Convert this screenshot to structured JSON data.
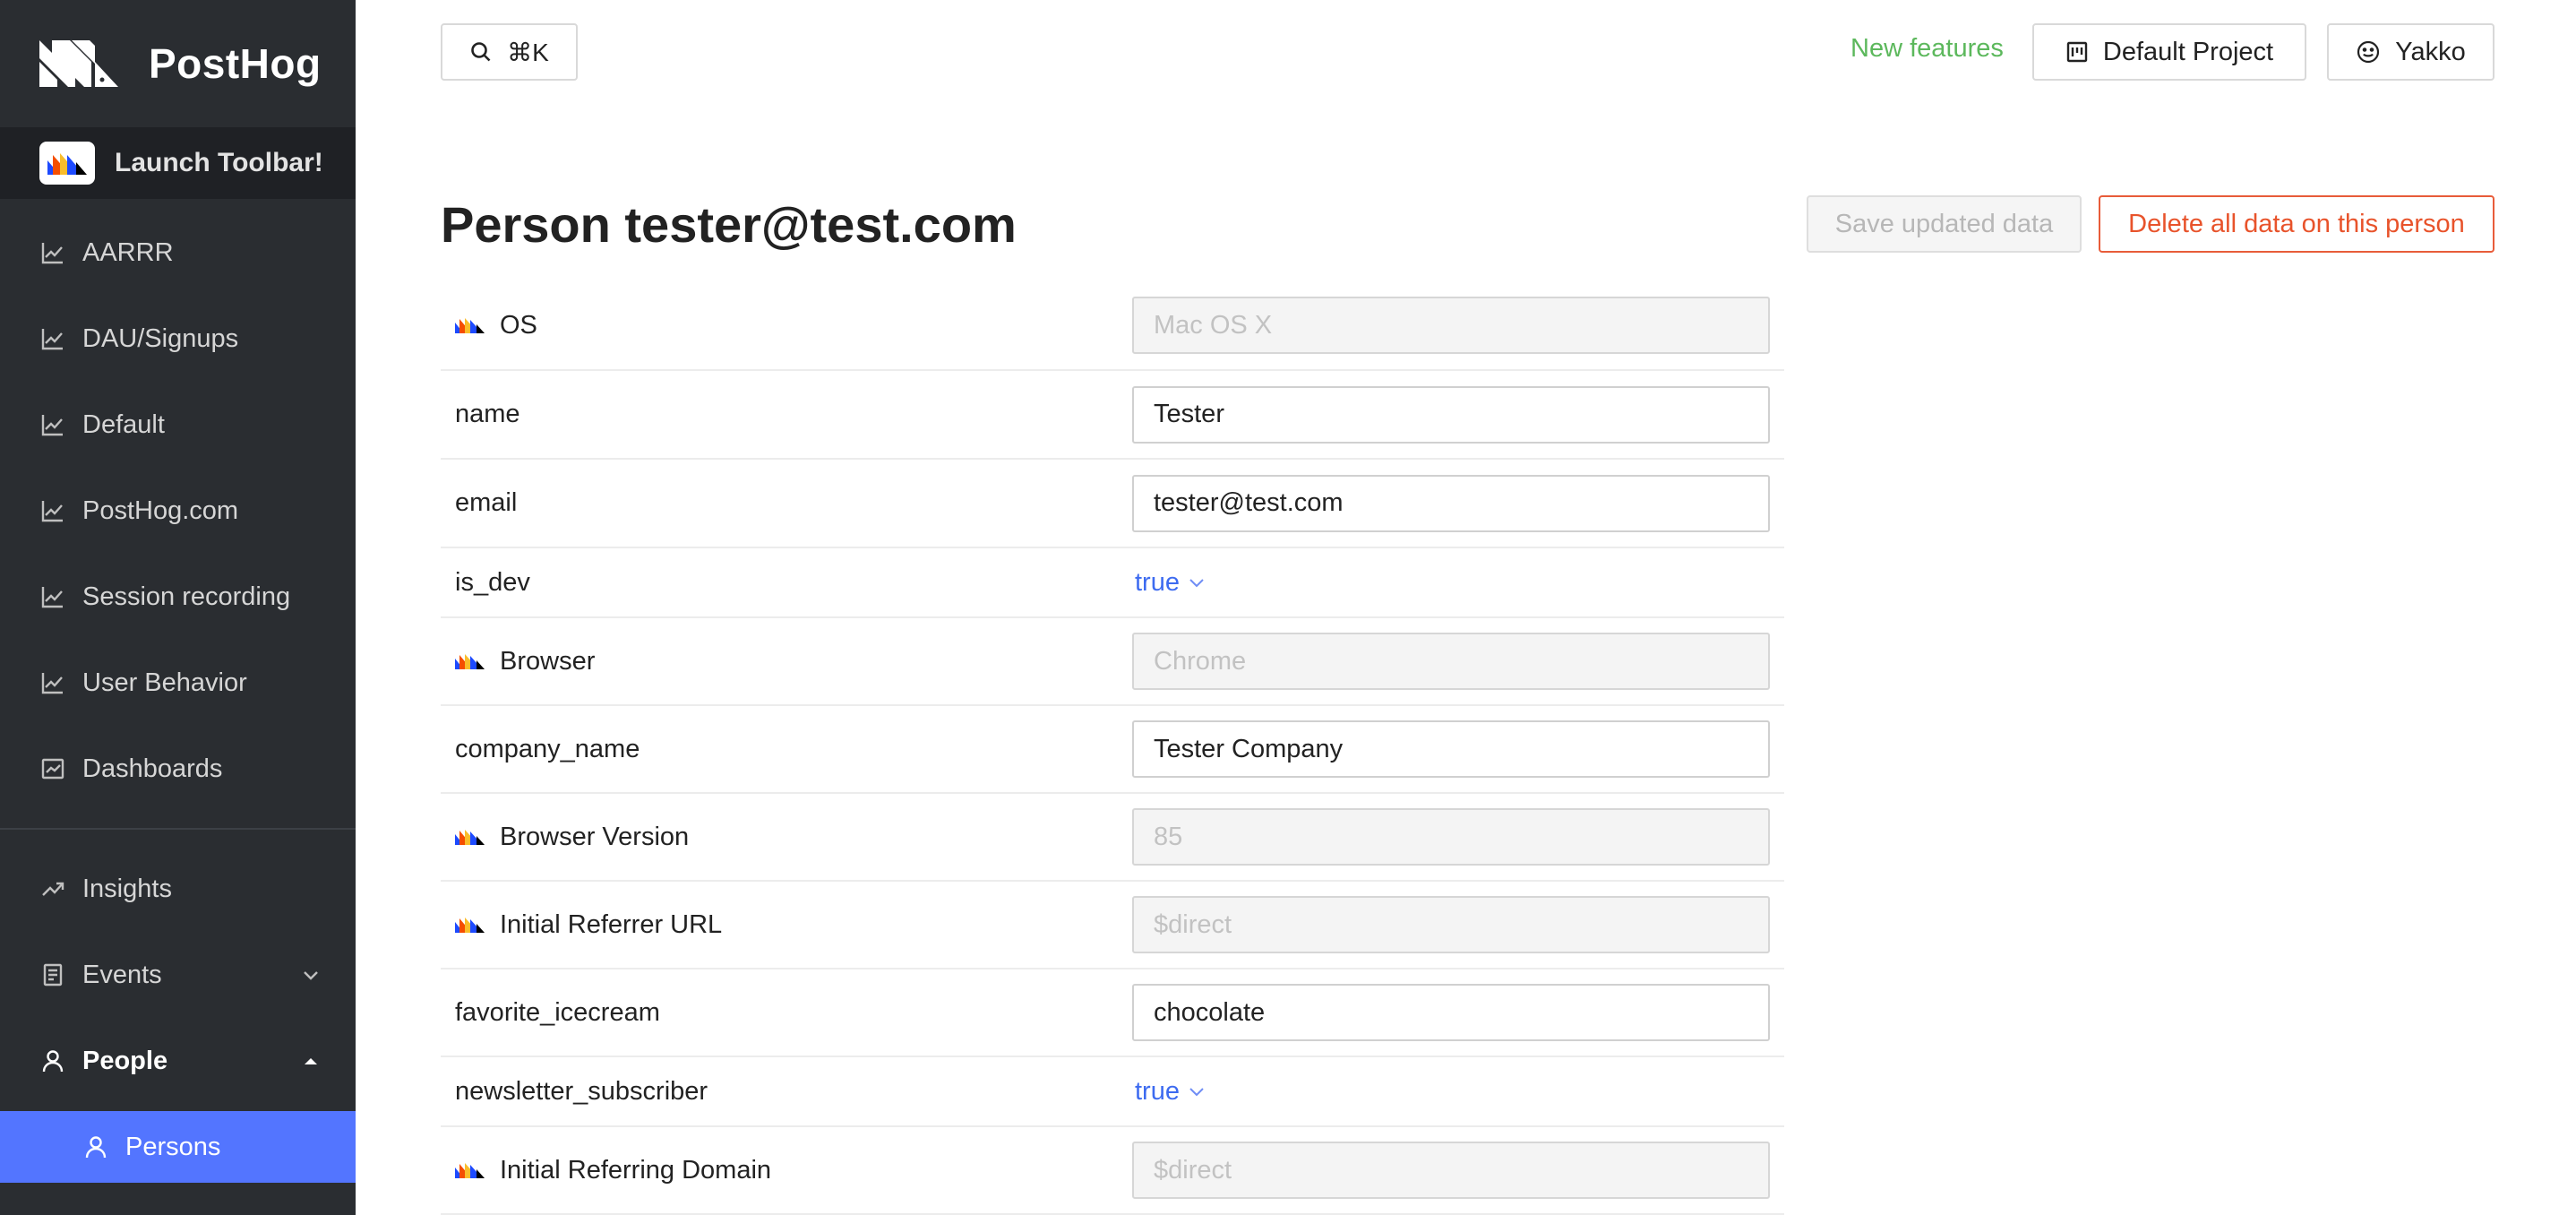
{
  "app": {
    "name": "PostHog"
  },
  "sidebar": {
    "launch_label": "Launch Toolbar!",
    "items": [
      {
        "label": "AARRR",
        "icon": "line-chart-icon"
      },
      {
        "label": "DAU/Signups",
        "icon": "line-chart-icon"
      },
      {
        "label": "Default",
        "icon": "line-chart-icon"
      },
      {
        "label": "PostHog.com",
        "icon": "line-chart-icon"
      },
      {
        "label": "Session recording",
        "icon": "line-chart-icon"
      },
      {
        "label": "User Behavior",
        "icon": "line-chart-icon"
      },
      {
        "label": "Dashboards",
        "icon": "dashboard-icon"
      }
    ],
    "main": [
      {
        "label": "Insights",
        "icon": "rise-icon"
      },
      {
        "label": "Events",
        "icon": "container-icon",
        "chevron": "down"
      },
      {
        "label": "People",
        "icon": "user-icon",
        "chevron": "up"
      }
    ],
    "active": {
      "label": "Persons",
      "icon": "user-icon"
    }
  },
  "topbar": {
    "search_shortcut": "⌘K",
    "new_features": "New features",
    "project": "Default Project",
    "user": "Yakko"
  },
  "page": {
    "title": "Person tester@test.com",
    "save_label": "Save updated data",
    "delete_label": "Delete all data on this person"
  },
  "properties": [
    {
      "key": "OS",
      "value": "Mac OS X",
      "posthog": true,
      "type": "readonly"
    },
    {
      "key": "name",
      "value": "Tester",
      "posthog": false,
      "type": "text"
    },
    {
      "key": "email",
      "value": "tester@test.com",
      "posthog": false,
      "type": "text"
    },
    {
      "key": "is_dev",
      "value": "true",
      "posthog": false,
      "type": "bool"
    },
    {
      "key": "Browser",
      "value": "Chrome",
      "posthog": true,
      "type": "readonly"
    },
    {
      "key": "company_name",
      "value": "Tester Company",
      "posthog": false,
      "type": "text"
    },
    {
      "key": "Browser Version",
      "value": "85",
      "posthog": true,
      "type": "readonly"
    },
    {
      "key": "Initial Referrer URL",
      "value": "$direct",
      "posthog": true,
      "type": "readonly"
    },
    {
      "key": "favorite_icecream",
      "value": "chocolate",
      "posthog": false,
      "type": "text"
    },
    {
      "key": "newsletter_subscriber",
      "value": "true",
      "posthog": false,
      "type": "bool"
    },
    {
      "key": "Initial Referring Domain",
      "value": "$direct",
      "posthog": true,
      "type": "readonly"
    }
  ],
  "colors": {
    "sidebar_bg": "#2a2d31",
    "active_bg": "#5375ff",
    "danger": "#e8532b",
    "link": "#3d6bf0",
    "new_features": "#5cb85c"
  }
}
